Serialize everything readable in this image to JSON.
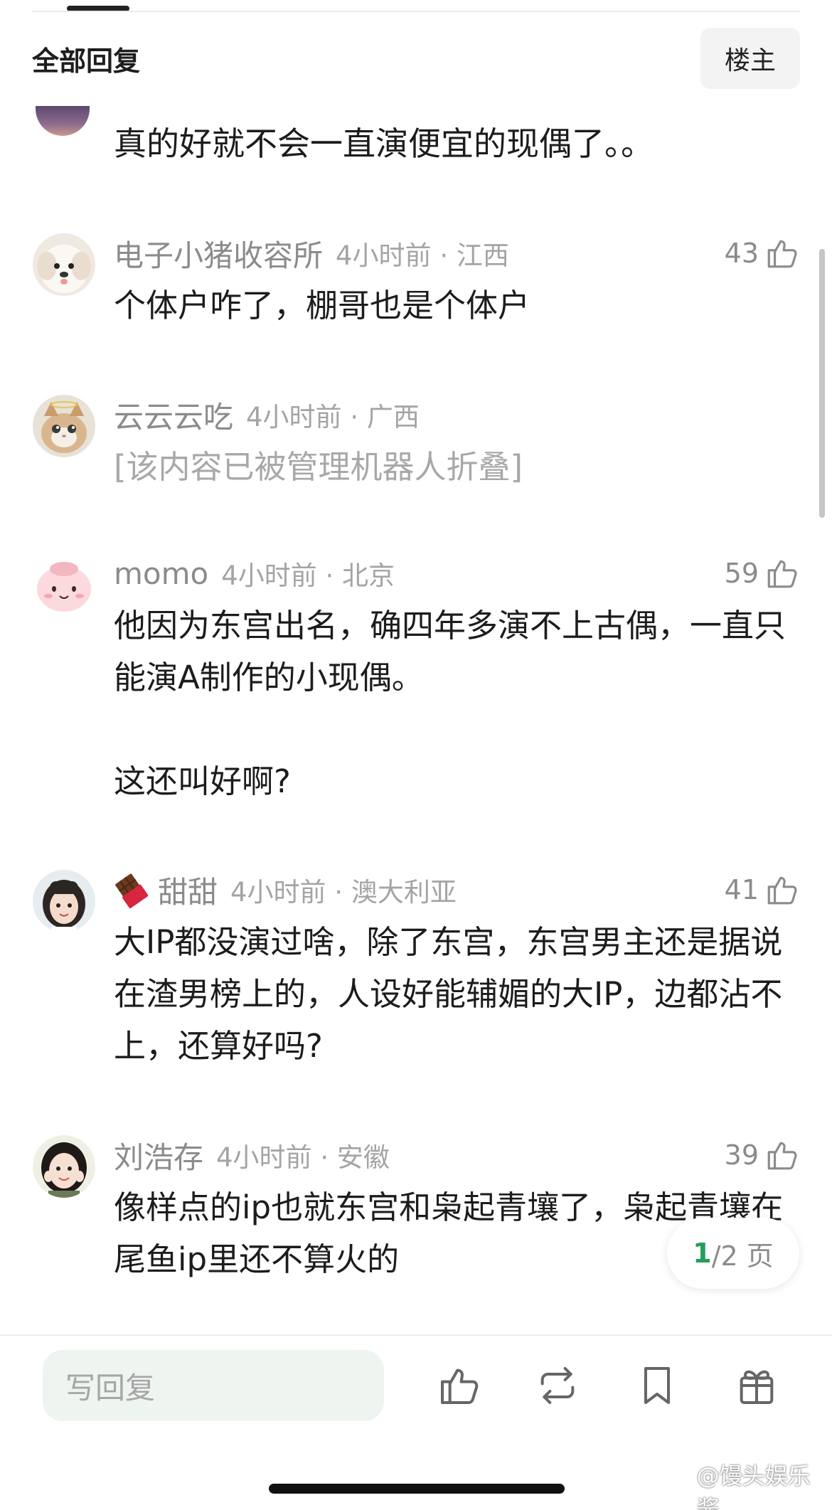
{
  "header": {
    "title": "全部回复",
    "op_button": "楼主"
  },
  "partial_comment": {
    "text": "真的好就不会一直演便宜的现偶了。。"
  },
  "comments": [
    {
      "username": "电子小猪收容所",
      "time_location": "4小时前 · 江西",
      "likes": "43",
      "text": "个体户咋了，棚哥也是个体户",
      "folded": false
    },
    {
      "username": "云云云吃",
      "time_location": "4小时前 · 广西",
      "likes": "",
      "text": "[该内容已被管理机器人折叠]",
      "folded": true
    },
    {
      "username": "momo",
      "time_location": "4小时前 · 北京",
      "likes": "59",
      "text": "他因为东宫出名，确四年多演不上古偶，一直只能演A制作的小现偶。\n\n这还叫好啊?",
      "folded": false
    },
    {
      "username": "甜甜",
      "time_location": "4小时前 · 澳大利亚",
      "likes": "41",
      "text": "大IP都没演过啥，除了东宫，东宫男主还是据说在渣男榜上的，人设好能辅媚的大IP，边都沾不上，还算好吗?",
      "folded": false
    },
    {
      "username": "刘浩存",
      "time_location": "4小时前 · 安徽",
      "likes": "39",
      "text": "像样点的ip也就东宫和枭起青壤了，枭起青壤在尾鱼ip里还不算火的",
      "folded": false
    }
  ],
  "pager": {
    "current": "1",
    "rest": "/2 页"
  },
  "bottom_bar": {
    "reply_placeholder": "写回复"
  },
  "watermark": "@馒头娱乐酱",
  "icons": {
    "like": "thumbs-up-icon",
    "repost": "repost-icon",
    "bookmark": "bookmark-icon",
    "gift": "gift-icon"
  },
  "colors": {
    "accent": "#23a05a",
    "meta_text": "#8b8b8b",
    "input_bg": "#eef4ef"
  }
}
